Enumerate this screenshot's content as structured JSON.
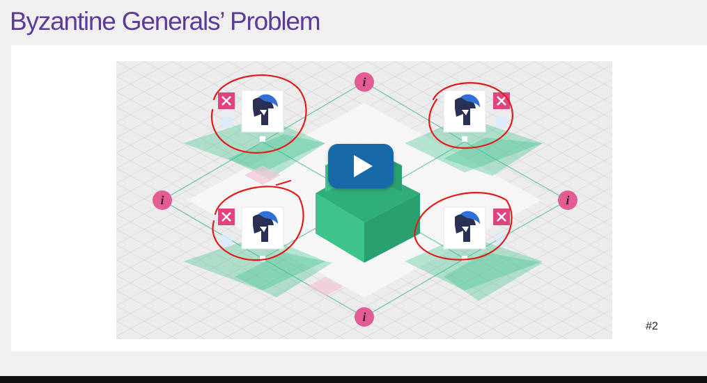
{
  "slide": {
    "title": "Byzantine Generals’ Problem",
    "number": "#2"
  },
  "video": {
    "play_icon": "play-icon",
    "general_icon": "spartan-helmet-icon",
    "info_icon": "info-icon",
    "status_icon": "crossed-swords-icon",
    "info_glyph": "i",
    "colors": {
      "play_button": "#1869a8",
      "info_marker": "#e25d93",
      "tile_green": "#3dc48d",
      "annotation_red": "#e21a1a",
      "title_purple": "#5b3a9a"
    }
  }
}
